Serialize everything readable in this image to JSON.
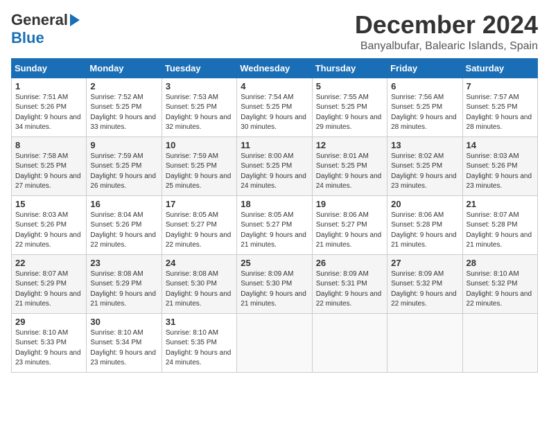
{
  "header": {
    "logo": {
      "line1": "General",
      "line2": "Blue",
      "arrow": "►"
    },
    "title": "December 2024",
    "location": "Banyalbufar, Balearic Islands, Spain"
  },
  "weekdays": [
    "Sunday",
    "Monday",
    "Tuesday",
    "Wednesday",
    "Thursday",
    "Friday",
    "Saturday"
  ],
  "days": [
    {
      "date": 1,
      "sunrise": "7:51 AM",
      "sunset": "5:26 PM",
      "daylight": "9 hours and 34 minutes."
    },
    {
      "date": 2,
      "sunrise": "7:52 AM",
      "sunset": "5:25 PM",
      "daylight": "9 hours and 33 minutes."
    },
    {
      "date": 3,
      "sunrise": "7:53 AM",
      "sunset": "5:25 PM",
      "daylight": "9 hours and 32 minutes."
    },
    {
      "date": 4,
      "sunrise": "7:54 AM",
      "sunset": "5:25 PM",
      "daylight": "9 hours and 30 minutes."
    },
    {
      "date": 5,
      "sunrise": "7:55 AM",
      "sunset": "5:25 PM",
      "daylight": "9 hours and 29 minutes."
    },
    {
      "date": 6,
      "sunrise": "7:56 AM",
      "sunset": "5:25 PM",
      "daylight": "9 hours and 28 minutes."
    },
    {
      "date": 7,
      "sunrise": "7:57 AM",
      "sunset": "5:25 PM",
      "daylight": "9 hours and 28 minutes."
    },
    {
      "date": 8,
      "sunrise": "7:58 AM",
      "sunset": "5:25 PM",
      "daylight": "9 hours and 27 minutes."
    },
    {
      "date": 9,
      "sunrise": "7:59 AM",
      "sunset": "5:25 PM",
      "daylight": "9 hours and 26 minutes."
    },
    {
      "date": 10,
      "sunrise": "7:59 AM",
      "sunset": "5:25 PM",
      "daylight": "9 hours and 25 minutes."
    },
    {
      "date": 11,
      "sunrise": "8:00 AM",
      "sunset": "5:25 PM",
      "daylight": "9 hours and 24 minutes."
    },
    {
      "date": 12,
      "sunrise": "8:01 AM",
      "sunset": "5:25 PM",
      "daylight": "9 hours and 24 minutes."
    },
    {
      "date": 13,
      "sunrise": "8:02 AM",
      "sunset": "5:25 PM",
      "daylight": "9 hours and 23 minutes."
    },
    {
      "date": 14,
      "sunrise": "8:03 AM",
      "sunset": "5:26 PM",
      "daylight": "9 hours and 23 minutes."
    },
    {
      "date": 15,
      "sunrise": "8:03 AM",
      "sunset": "5:26 PM",
      "daylight": "9 hours and 22 minutes."
    },
    {
      "date": 16,
      "sunrise": "8:04 AM",
      "sunset": "5:26 PM",
      "daylight": "9 hours and 22 minutes."
    },
    {
      "date": 17,
      "sunrise": "8:05 AM",
      "sunset": "5:27 PM",
      "daylight": "9 hours and 22 minutes."
    },
    {
      "date": 18,
      "sunrise": "8:05 AM",
      "sunset": "5:27 PM",
      "daylight": "9 hours and 21 minutes."
    },
    {
      "date": 19,
      "sunrise": "8:06 AM",
      "sunset": "5:27 PM",
      "daylight": "9 hours and 21 minutes."
    },
    {
      "date": 20,
      "sunrise": "8:06 AM",
      "sunset": "5:28 PM",
      "daylight": "9 hours and 21 minutes."
    },
    {
      "date": 21,
      "sunrise": "8:07 AM",
      "sunset": "5:28 PM",
      "daylight": "9 hours and 21 minutes."
    },
    {
      "date": 22,
      "sunrise": "8:07 AM",
      "sunset": "5:29 PM",
      "daylight": "9 hours and 21 minutes."
    },
    {
      "date": 23,
      "sunrise": "8:08 AM",
      "sunset": "5:29 PM",
      "daylight": "9 hours and 21 minutes."
    },
    {
      "date": 24,
      "sunrise": "8:08 AM",
      "sunset": "5:30 PM",
      "daylight": "9 hours and 21 minutes."
    },
    {
      "date": 25,
      "sunrise": "8:09 AM",
      "sunset": "5:30 PM",
      "daylight": "9 hours and 21 minutes."
    },
    {
      "date": 26,
      "sunrise": "8:09 AM",
      "sunset": "5:31 PM",
      "daylight": "9 hours and 22 minutes."
    },
    {
      "date": 27,
      "sunrise": "8:09 AM",
      "sunset": "5:32 PM",
      "daylight": "9 hours and 22 minutes."
    },
    {
      "date": 28,
      "sunrise": "8:10 AM",
      "sunset": "5:32 PM",
      "daylight": "9 hours and 22 minutes."
    },
    {
      "date": 29,
      "sunrise": "8:10 AM",
      "sunset": "5:33 PM",
      "daylight": "9 hours and 23 minutes."
    },
    {
      "date": 30,
      "sunrise": "8:10 AM",
      "sunset": "5:34 PM",
      "daylight": "9 hours and 23 minutes."
    },
    {
      "date": 31,
      "sunrise": "8:10 AM",
      "sunset": "5:35 PM",
      "daylight": "9 hours and 24 minutes."
    }
  ],
  "startDayOfWeek": 0,
  "labels": {
    "sunrise": "Sunrise:",
    "sunset": "Sunset:",
    "daylight": "Daylight:"
  }
}
